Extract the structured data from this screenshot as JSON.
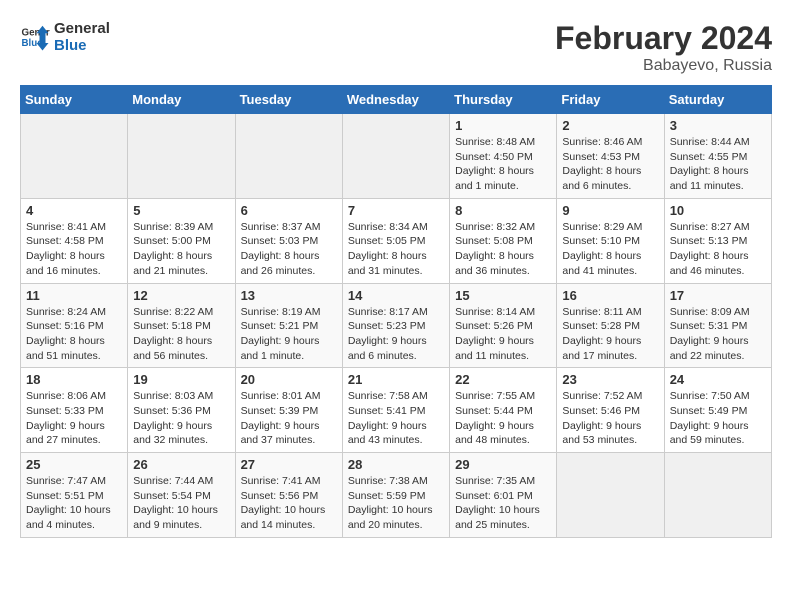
{
  "header": {
    "logo_line1": "General",
    "logo_line2": "Blue",
    "month": "February 2024",
    "location": "Babayevo, Russia"
  },
  "weekdays": [
    "Sunday",
    "Monday",
    "Tuesday",
    "Wednesday",
    "Thursday",
    "Friday",
    "Saturday"
  ],
  "weeks": [
    [
      {
        "day": "",
        "info": ""
      },
      {
        "day": "",
        "info": ""
      },
      {
        "day": "",
        "info": ""
      },
      {
        "day": "",
        "info": ""
      },
      {
        "day": "1",
        "info": "Sunrise: 8:48 AM\nSunset: 4:50 PM\nDaylight: 8 hours and 1 minute."
      },
      {
        "day": "2",
        "info": "Sunrise: 8:46 AM\nSunset: 4:53 PM\nDaylight: 8 hours and 6 minutes."
      },
      {
        "day": "3",
        "info": "Sunrise: 8:44 AM\nSunset: 4:55 PM\nDaylight: 8 hours and 11 minutes."
      }
    ],
    [
      {
        "day": "4",
        "info": "Sunrise: 8:41 AM\nSunset: 4:58 PM\nDaylight: 8 hours and 16 minutes."
      },
      {
        "day": "5",
        "info": "Sunrise: 8:39 AM\nSunset: 5:00 PM\nDaylight: 8 hours and 21 minutes."
      },
      {
        "day": "6",
        "info": "Sunrise: 8:37 AM\nSunset: 5:03 PM\nDaylight: 8 hours and 26 minutes."
      },
      {
        "day": "7",
        "info": "Sunrise: 8:34 AM\nSunset: 5:05 PM\nDaylight: 8 hours and 31 minutes."
      },
      {
        "day": "8",
        "info": "Sunrise: 8:32 AM\nSunset: 5:08 PM\nDaylight: 8 hours and 36 minutes."
      },
      {
        "day": "9",
        "info": "Sunrise: 8:29 AM\nSunset: 5:10 PM\nDaylight: 8 hours and 41 minutes."
      },
      {
        "day": "10",
        "info": "Sunrise: 8:27 AM\nSunset: 5:13 PM\nDaylight: 8 hours and 46 minutes."
      }
    ],
    [
      {
        "day": "11",
        "info": "Sunrise: 8:24 AM\nSunset: 5:16 PM\nDaylight: 8 hours and 51 minutes."
      },
      {
        "day": "12",
        "info": "Sunrise: 8:22 AM\nSunset: 5:18 PM\nDaylight: 8 hours and 56 minutes."
      },
      {
        "day": "13",
        "info": "Sunrise: 8:19 AM\nSunset: 5:21 PM\nDaylight: 9 hours and 1 minute."
      },
      {
        "day": "14",
        "info": "Sunrise: 8:17 AM\nSunset: 5:23 PM\nDaylight: 9 hours and 6 minutes."
      },
      {
        "day": "15",
        "info": "Sunrise: 8:14 AM\nSunset: 5:26 PM\nDaylight: 9 hours and 11 minutes."
      },
      {
        "day": "16",
        "info": "Sunrise: 8:11 AM\nSunset: 5:28 PM\nDaylight: 9 hours and 17 minutes."
      },
      {
        "day": "17",
        "info": "Sunrise: 8:09 AM\nSunset: 5:31 PM\nDaylight: 9 hours and 22 minutes."
      }
    ],
    [
      {
        "day": "18",
        "info": "Sunrise: 8:06 AM\nSunset: 5:33 PM\nDaylight: 9 hours and 27 minutes."
      },
      {
        "day": "19",
        "info": "Sunrise: 8:03 AM\nSunset: 5:36 PM\nDaylight: 9 hours and 32 minutes."
      },
      {
        "day": "20",
        "info": "Sunrise: 8:01 AM\nSunset: 5:39 PM\nDaylight: 9 hours and 37 minutes."
      },
      {
        "day": "21",
        "info": "Sunrise: 7:58 AM\nSunset: 5:41 PM\nDaylight: 9 hours and 43 minutes."
      },
      {
        "day": "22",
        "info": "Sunrise: 7:55 AM\nSunset: 5:44 PM\nDaylight: 9 hours and 48 minutes."
      },
      {
        "day": "23",
        "info": "Sunrise: 7:52 AM\nSunset: 5:46 PM\nDaylight: 9 hours and 53 minutes."
      },
      {
        "day": "24",
        "info": "Sunrise: 7:50 AM\nSunset: 5:49 PM\nDaylight: 9 hours and 59 minutes."
      }
    ],
    [
      {
        "day": "25",
        "info": "Sunrise: 7:47 AM\nSunset: 5:51 PM\nDaylight: 10 hours and 4 minutes."
      },
      {
        "day": "26",
        "info": "Sunrise: 7:44 AM\nSunset: 5:54 PM\nDaylight: 10 hours and 9 minutes."
      },
      {
        "day": "27",
        "info": "Sunrise: 7:41 AM\nSunset: 5:56 PM\nDaylight: 10 hours and 14 minutes."
      },
      {
        "day": "28",
        "info": "Sunrise: 7:38 AM\nSunset: 5:59 PM\nDaylight: 10 hours and 20 minutes."
      },
      {
        "day": "29",
        "info": "Sunrise: 7:35 AM\nSunset: 6:01 PM\nDaylight: 10 hours and 25 minutes."
      },
      {
        "day": "",
        "info": ""
      },
      {
        "day": "",
        "info": ""
      }
    ]
  ]
}
